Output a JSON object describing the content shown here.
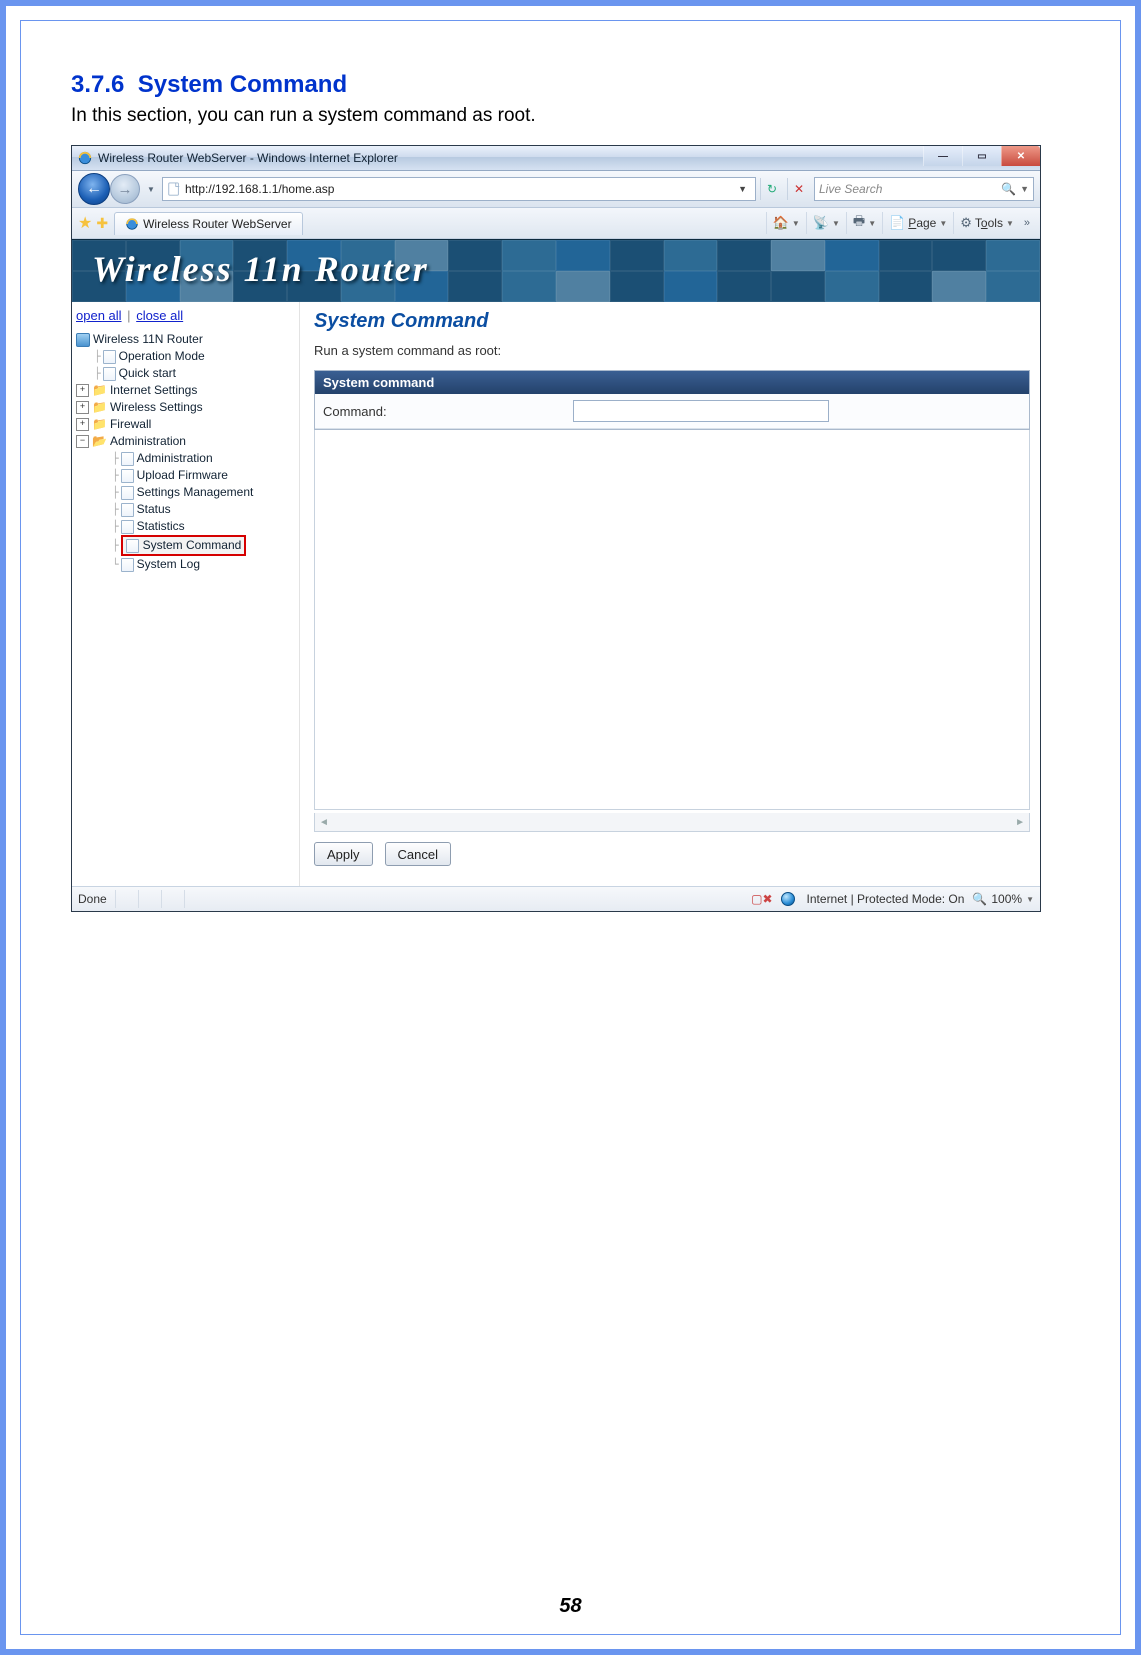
{
  "doc": {
    "section_number": "3.7.6",
    "section_title": "System Command",
    "section_text": "In this section, you can run a system command as root.",
    "page_number": "58"
  },
  "browser": {
    "window_title": "Wireless Router WebServer - Windows Internet Explorer",
    "url": "http://192.168.1.1/home.asp",
    "search_placeholder": "Live Search",
    "tab_title": "Wireless Router WebServer",
    "toolbar": {
      "page": "Page",
      "tools": "Tools"
    },
    "status_left": "Done",
    "status_zone": "Internet | Protected Mode: On",
    "status_zoom": "100%",
    "banner": "Wireless 11n Router"
  },
  "sidebar": {
    "open_all": "open all",
    "close_all": "close all",
    "root": "Wireless 11N Router",
    "items": {
      "op_mode": "Operation Mode",
      "quick_start": "Quick start",
      "internet": "Internet Settings",
      "wireless": "Wireless Settings",
      "firewall": "Firewall",
      "admin": "Administration",
      "admin_sub": {
        "administration": "Administration",
        "upload_fw": "Upload Firmware",
        "settings_mgmt": "Settings Management",
        "status": "Status",
        "statistics": "Statistics",
        "sys_cmd": "System Command",
        "sys_log": "System Log"
      }
    }
  },
  "main": {
    "heading": "System Command",
    "sub": "Run a system command as root:",
    "panel_title": "System command",
    "field_label": "Command:",
    "apply": "Apply",
    "cancel": "Cancel"
  }
}
